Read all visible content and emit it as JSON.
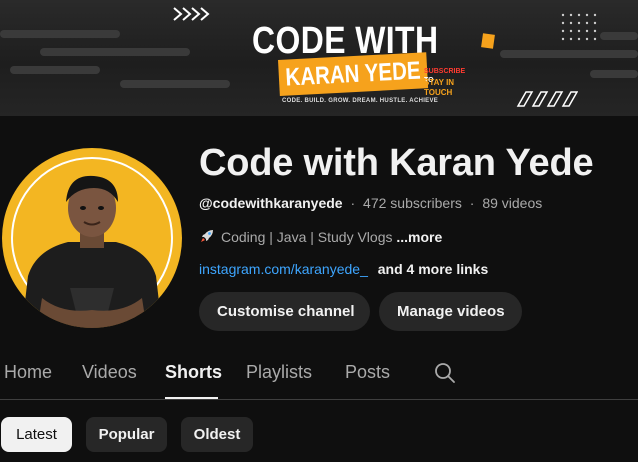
{
  "banner": {
    "title_line1": "CODE WITH",
    "title_line2": "KARAN YEDE",
    "subscribe": "SUBSCRIBE",
    "subscribe_to": " TO",
    "stay_in_touch": "STAY IN TOUCH",
    "motto": "CODE. BUILD. GROW. DREAM. HUSTLE. ACHIEVE",
    "accent_color": "#f6a21c"
  },
  "channel": {
    "name": "Code with Karan Yede",
    "handle": "@codewithkaranyede",
    "subscribers": "472 subscribers",
    "videos": "89 videos",
    "separator": "·",
    "description": "Coding | Java | Study Vlogs",
    "description_icon": "rocket-icon",
    "more_label": "...more",
    "link": "instagram.com/karanyede_",
    "more_links": "and 4 more links",
    "avatar_bg": "#f3b622"
  },
  "actions": {
    "customise": "Customise channel",
    "manage": "Manage videos"
  },
  "tabs": [
    {
      "label": "Home",
      "active": false
    },
    {
      "label": "Videos",
      "active": false
    },
    {
      "label": "Shorts",
      "active": true
    },
    {
      "label": "Playlists",
      "active": false
    },
    {
      "label": "Posts",
      "active": false
    }
  ],
  "search_icon": "search-icon",
  "filters": [
    {
      "label": "Latest",
      "active": true
    },
    {
      "label": "Popular",
      "active": false
    },
    {
      "label": "Oldest",
      "active": false
    }
  ],
  "colors": {
    "background": "#0f0f0f",
    "link": "#3ea6ff",
    "chip": "#272727"
  }
}
